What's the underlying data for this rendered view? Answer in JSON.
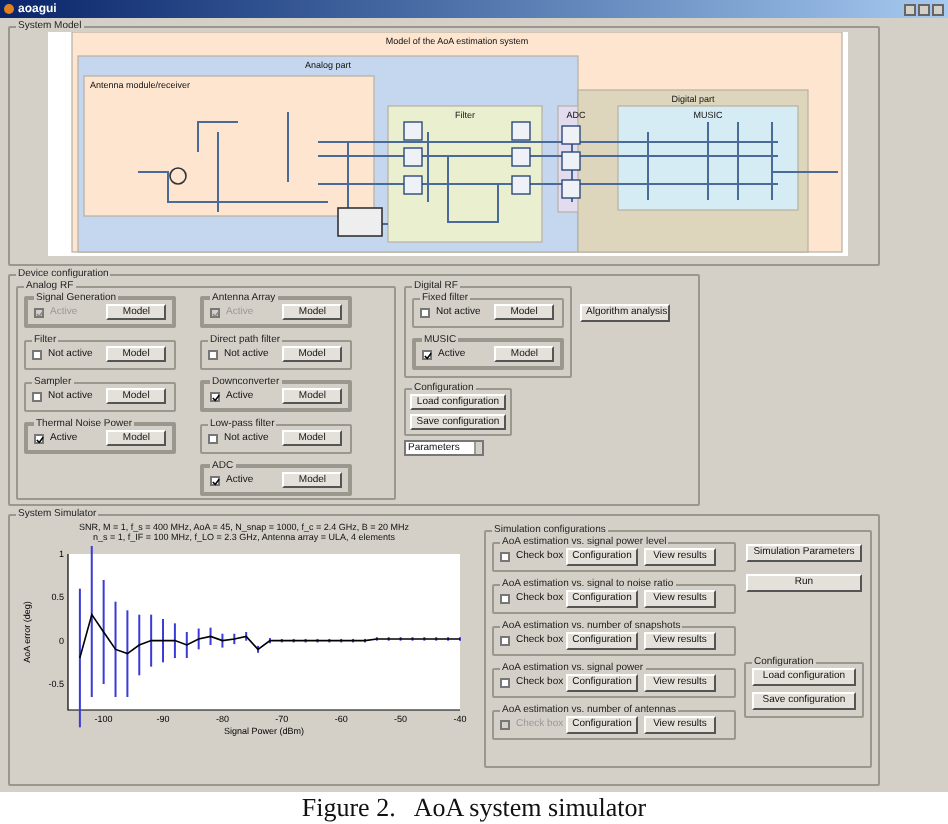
{
  "window": {
    "title": "aoagui"
  },
  "system_model": {
    "label": "System Model",
    "diagram": {
      "blocks": [
        {
          "kind": "outer",
          "label": "Model of the AoA estimation system"
        },
        {
          "kind": "analog",
          "label": "Analog part"
        },
        {
          "kind": "antenna",
          "label": "Antenna module/receiver"
        },
        {
          "kind": "filter",
          "label": "Filter"
        },
        {
          "kind": "adc",
          "label": "ADC"
        },
        {
          "kind": "digital",
          "label": "Digital part"
        },
        {
          "kind": "music",
          "label": "MUSIC"
        }
      ]
    }
  },
  "device_configuration": {
    "label": "Device configuration",
    "analog_rf": {
      "label": "Analog RF",
      "columns": [
        [
          {
            "label": "Signal Generation",
            "checked": true,
            "disabled": true,
            "option": "Active",
            "button": "Model"
          },
          {
            "label": "Filter",
            "checked": false,
            "disabled": false,
            "option": "Not active",
            "button": "Model"
          },
          {
            "label": "Sampler",
            "checked": false,
            "disabled": false,
            "option": "Not active",
            "button": "Model"
          },
          {
            "label": "Thermal Noise Power",
            "checked": true,
            "disabled": false,
            "option": "Active",
            "button": "Model"
          }
        ],
        [
          {
            "label": "Antenna Array",
            "checked": true,
            "disabled": true,
            "option": "Active",
            "button": "Model"
          },
          {
            "label": "Direct path filter",
            "checked": false,
            "disabled": false,
            "option": "Not active",
            "button": "Model"
          },
          {
            "label": "Downconverter",
            "checked": true,
            "disabled": false,
            "option": "Active",
            "button": "Model"
          },
          {
            "label": "Low-pass filter",
            "checked": false,
            "disabled": false,
            "option": "Not active",
            "button": "Model"
          },
          {
            "label": "ADC",
            "checked": true,
            "disabled": false,
            "option": "Active",
            "button": "Model"
          }
        ]
      ]
    },
    "digital_rf": {
      "label": "Digital RF",
      "groups": [
        {
          "label": "Fixed filter",
          "checked": false,
          "disabled": false,
          "option": "Not active",
          "button": "Model"
        },
        {
          "label": "MUSIC",
          "checked": true,
          "disabled": false,
          "option": "Active",
          "button": "Model"
        }
      ]
    },
    "algorithm_button": "Algorithm analysis",
    "configuration": {
      "label": "Configuration",
      "buttons": [
        "Load configuration",
        "Save configuration"
      ]
    },
    "dropdown": {
      "value": "Parameters"
    }
  },
  "system_simulator": {
    "label": "System Simulator",
    "plot_title": [
      "SNR, M = 1, f_s = 400 MHz, AoA = 45, N_snap = 1000, f_c = 2.4 GHz, B = 20 MHz",
      "n_s = 1, f_IF = 100 MHz, f_LO = 2.3 GHz, Antenna array = ULA, 4 elements"
    ],
    "chart_data": {
      "type": "line",
      "xlabel": "Signal Power (dBm)",
      "ylabel": "AoA error (deg)",
      "x": [
        -104,
        -102,
        -100,
        -98,
        -96,
        -94,
        -92,
        -90,
        -88,
        -86,
        -84,
        -82,
        -80,
        -78,
        -76,
        -74,
        -72,
        -70,
        -68,
        -66,
        -64,
        -62,
        -60,
        -58,
        -56,
        -54,
        -52,
        -50,
        -48,
        -46,
        -44,
        -42,
        -40
      ],
      "series": [
        {
          "color": "#000000",
          "values": [
            -0.2,
            0.3,
            0.1,
            -0.1,
            -0.15,
            -0.05,
            0.0,
            0.0,
            0.0,
            -0.05,
            0.02,
            0.05,
            0.0,
            0.02,
            0.05,
            -0.1,
            0.0,
            0.0,
            0.0,
            0.0,
            0.0,
            0.0,
            0.0,
            0.0,
            0.0,
            0.02,
            0.02,
            0.02,
            0.02,
            0.02,
            0.02,
            0.02,
            0.02
          ],
          "errors": [
            0.8,
            0.95,
            0.6,
            0.55,
            0.5,
            0.35,
            0.3,
            0.25,
            0.2,
            0.15,
            0.12,
            0.1,
            0.08,
            0.06,
            0.05,
            0.04,
            0.03,
            0.02,
            0.02,
            0.02,
            0.02,
            0.02,
            0.02,
            0.02,
            0.02,
            0.02,
            0.02,
            0.02,
            0.02,
            0.02,
            0.02,
            0.02,
            0.02
          ]
        }
      ],
      "xlim": [
        -106,
        -40
      ],
      "ylim": [
        -0.8,
        1
      ],
      "xticks": [
        -100,
        -90,
        -80,
        -70,
        -60,
        -50,
        -40
      ],
      "yticks": [
        -0.5,
        0,
        0.5,
        1
      ]
    },
    "simulation_configurations": {
      "label": "Simulation configurations",
      "groups": [
        {
          "label": "AoA estimation vs. signal power level",
          "checked": false,
          "disabled": false,
          "checkbox": "Check box",
          "buttons": [
            "Configuration",
            "View results"
          ]
        },
        {
          "label": "AoA estimation vs. signal to noise ratio",
          "checked": false,
          "disabled": false,
          "checkbox": "Check box",
          "buttons": [
            "Configuration",
            "View results"
          ]
        },
        {
          "label": "AoA estimation vs. number of snapshots",
          "checked": false,
          "disabled": false,
          "checkbox": "Check box",
          "buttons": [
            "Configuration",
            "View results"
          ]
        },
        {
          "label": "AoA estimation vs. signal power",
          "checked": false,
          "disabled": false,
          "checkbox": "Check box",
          "buttons": [
            "Configuration",
            "View results"
          ]
        },
        {
          "label": "AoA estimation vs. number of antennas",
          "checked": false,
          "disabled": true,
          "checkbox": "Check box",
          "buttons": [
            "Configuration",
            "View results"
          ]
        }
      ]
    },
    "side_buttons": [
      "Simulation Parameters",
      "Run"
    ],
    "configuration": {
      "label": "Configuration",
      "buttons": [
        "Load configuration",
        "Save configuration"
      ]
    }
  },
  "caption": "Figure 2.   AoA system simulator"
}
